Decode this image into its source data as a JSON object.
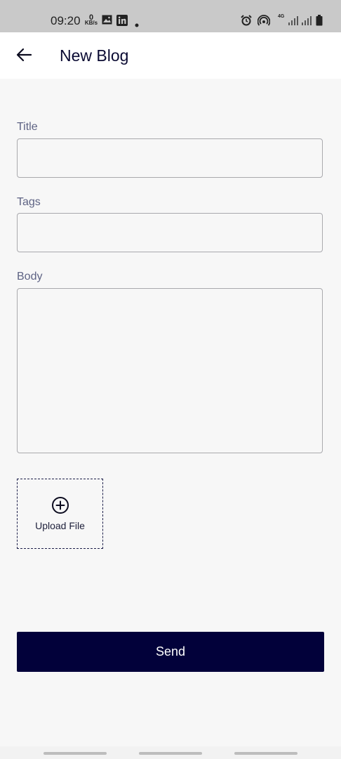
{
  "status_bar": {
    "time": "09:20",
    "speed_value": "0",
    "speed_unit": "KB/s",
    "network_label": "4G"
  },
  "app_bar": {
    "title": "New Blog",
    "back_icon": "arrow-left-icon"
  },
  "form": {
    "title": {
      "label": "Title",
      "value": "",
      "placeholder": ""
    },
    "tags": {
      "label": "Tags",
      "value": "",
      "placeholder": ""
    },
    "body": {
      "label": "Body",
      "value": "",
      "placeholder": ""
    }
  },
  "upload": {
    "label": "Upload File",
    "icon": "plus-circle-icon"
  },
  "send_button": {
    "label": "Send"
  },
  "colors": {
    "primary": "#02013a",
    "title_text": "#0b0b33",
    "label_text": "#5e6384",
    "background": "#f7f7f7",
    "status_bar": "#c9c9c9"
  }
}
